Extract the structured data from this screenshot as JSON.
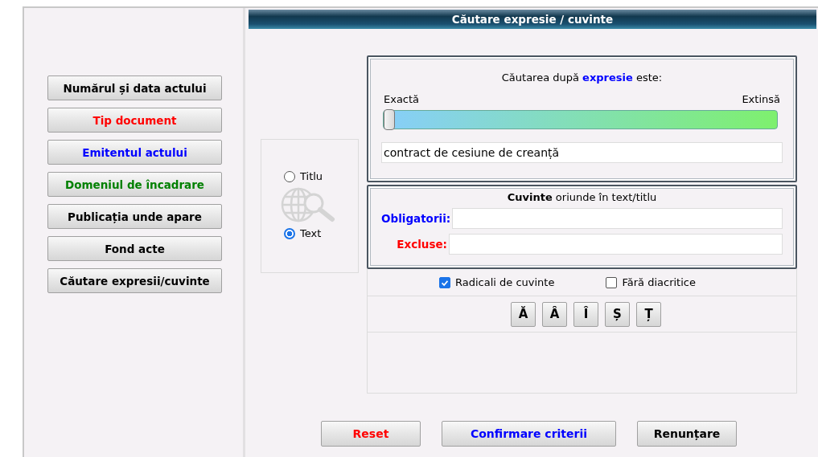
{
  "menu": [
    {
      "label": "Numărul și data actului",
      "color": "#000000"
    },
    {
      "label": "Tip document",
      "color": "#ff0000"
    },
    {
      "label": "Emitentul actului",
      "color": "#0000ff"
    },
    {
      "label": "Domeniul de încadrare",
      "color": "#008000"
    },
    {
      "label": "Publicația unde apare",
      "color": "#000000"
    },
    {
      "label": "Fond acte",
      "color": "#000000"
    },
    {
      "label": "Căutare expresii/cuvinte",
      "color": "#000000"
    }
  ],
  "panel_title": "Căutare expresie / cuvinte",
  "scope": [
    {
      "label": "Titlu",
      "selected": false
    },
    {
      "label": "Text",
      "selected": true
    }
  ],
  "expression": {
    "heading": "Căutarea după **expresie** este:",
    "min_label": "Exactă",
    "max_label": "Extinsă",
    "level": 0,
    "value": "contract de cesiune de creanță"
  },
  "words": {
    "heading": "**Cuvinte** oriunde în text/titlu",
    "fields": [
      {
        "label": "Obligatorii:",
        "color": "#0000ff"
      },
      {
        "label": "Excluse:",
        "color": "#ff0000"
      }
    ]
  },
  "options": [
    {
      "label": "Radicali de cuvinte",
      "checked": true
    },
    {
      "label": "Fără diacritice",
      "checked": false
    }
  ],
  "letters": [
    "Ă",
    "Â",
    "Î",
    "Ș",
    "Ț"
  ],
  "actions": [
    {
      "label": "Reset",
      "color": "#ff0000"
    },
    {
      "label": "Confirmare criterii",
      "color": "#0000ff"
    },
    {
      "label": "Renunțare",
      "color": "#000000"
    }
  ]
}
